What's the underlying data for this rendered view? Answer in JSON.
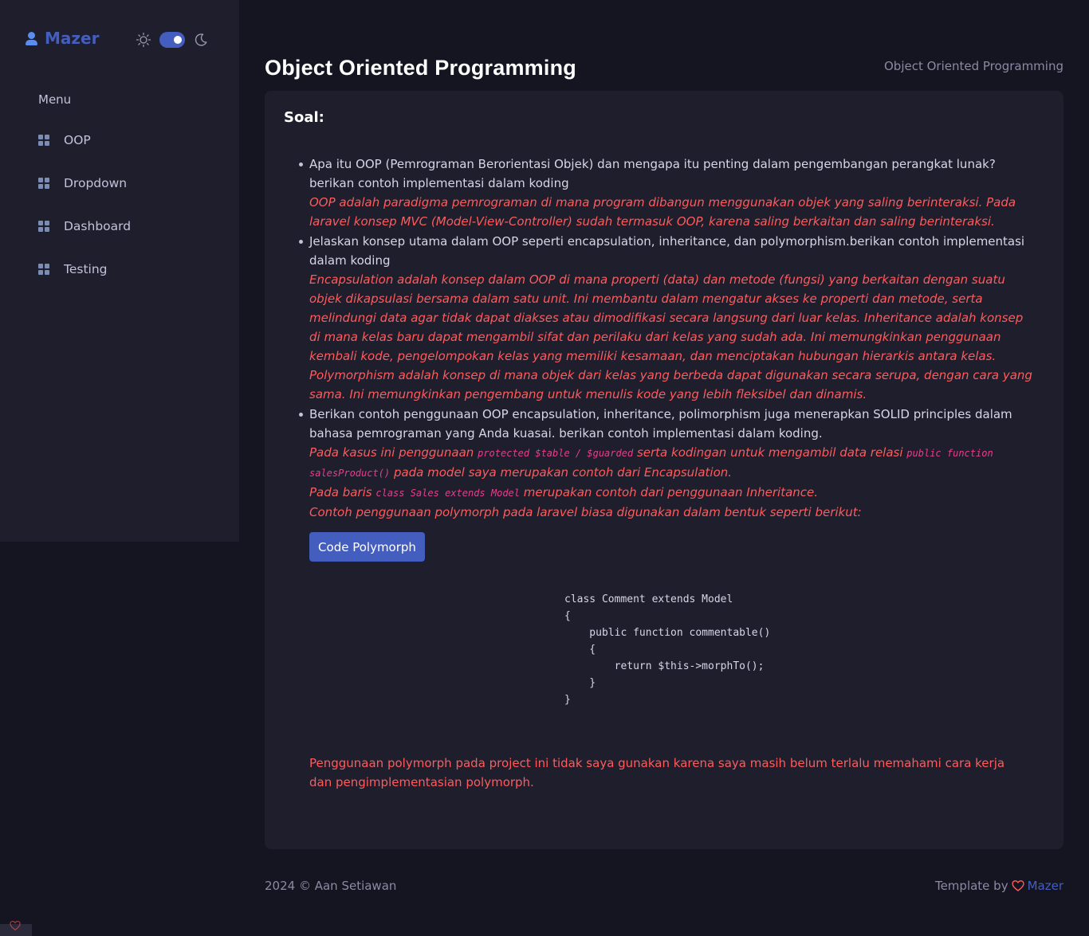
{
  "app": {
    "name": "Mazer"
  },
  "sidebar": {
    "menu_title": "Menu",
    "items": [
      {
        "label": "OOP",
        "icon": "grid-icon"
      },
      {
        "label": "Dropdown",
        "icon": "grid-icon"
      },
      {
        "label": "Dashboard",
        "icon": "grid-icon"
      },
      {
        "label": "Testing",
        "icon": "grid-icon"
      }
    ],
    "theme_toggle": {
      "state": "dark"
    }
  },
  "header": {
    "title": "Object Oriented Programming",
    "breadcrumb": "Object Oriented Programming"
  },
  "card": {
    "title": "Soal:",
    "items": [
      {
        "question": "Apa itu OOP (Pemrograman Berorientasi Objek) dan mengapa itu penting dalam pengembangan perangkat lunak?berikan contoh implementasi dalam koding",
        "answer": "OOP adalah paradigma pemrograman di mana program dibangun menggunakan objek yang saling berinteraksi. Pada laravel konsep MVC (Model-View-Controller) sudah termasuk OOP, karena saling berkaitan dan saling berinteraksi."
      },
      {
        "question": "Jelaskan konsep utama dalam OOP seperti encapsulation, inheritance, dan polymorphism.berikan contoh implementasi dalam koding",
        "answer": "Encapsulation adalah konsep dalam OOP di mana properti (data) dan metode (fungsi) yang berkaitan dengan suatu objek dikapsulasi bersama dalam satu unit. Ini membantu dalam mengatur akses ke properti dan metode, serta melindungi data agar tidak dapat diakses atau dimodifikasi secara langsung dari luar kelas. Inheritance adalah konsep di mana kelas baru dapat mengambil sifat dan perilaku dari kelas yang sudah ada. Ini memungkinkan penggunaan kembali kode, pengelompokan kelas yang memiliki kesamaan, dan menciptakan hubungan hierarkis antara kelas. Polymorphism adalah konsep di mana objek dari kelas yang berbeda dapat digunakan secara serupa, dengan cara yang sama. Ini memungkinkan pengembang untuk menulis kode yang lebih fleksibel dan dinamis."
      },
      {
        "question": "Berikan contoh penggunaan OOP encapsulation, inheritance, polimorphism juga menerapkan SOLID principles dalam bahasa pemrograman yang Anda kuasai. berikan contoh implementasi dalam koding.",
        "answer_1_pre": "Pada kasus ini penggunaan",
        "answer_1_code_a": "protected $table / $guarded",
        "answer_1_mid": "serta kodingan untuk mengambil data relasi",
        "answer_1_code_b": "public function salesProduct()",
        "answer_1_post": "pada model saya merupakan contoh dari Encapsulation.",
        "answer_2_pre": "Pada baris",
        "answer_2_code": "class Sales extends Model",
        "answer_2_post": "merupakan contoh dari penggunaan Inheritance.",
        "answer_3": "Contoh penggunaan polymorph pada laravel biasa digunakan dalam bentuk seperti berikut:"
      }
    ],
    "button_label": "Code Polymorph",
    "code": "class Comment extends Model\n{\n    public function commentable()\n    {\n        return $this->morphTo();\n    }\n}",
    "note": "Penggunaan polymorph pada project ini tidak saya gunakan karena saya masih belum terlalu memahami cara kerja dan pengimplementasian polymorph."
  },
  "footer": {
    "copyright": "2024 © Aan Setiawan",
    "template_by": "Template by",
    "brand": "Mazer"
  },
  "colors": {
    "background": "#151521",
    "panel": "#1e1e2d",
    "primary": "#435ebe",
    "answer": "#ff5b5c",
    "code_inline": "#e83e8c"
  }
}
